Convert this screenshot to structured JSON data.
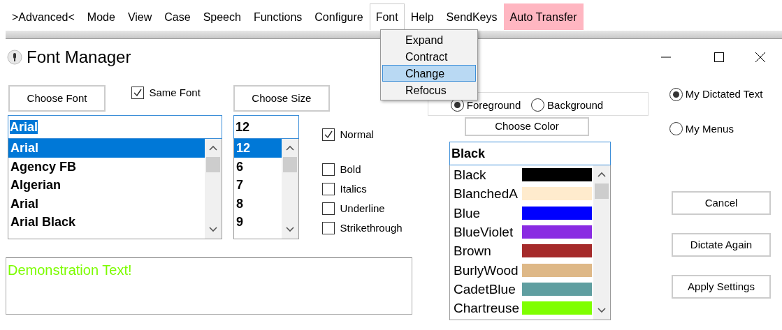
{
  "menu_bar": [
    {
      "label": ">Advanced<",
      "open": false,
      "highlighted": false
    },
    {
      "label": "Mode",
      "open": false,
      "highlighted": false
    },
    {
      "label": "View",
      "open": false,
      "highlighted": false
    },
    {
      "label": "Case",
      "open": false,
      "highlighted": false
    },
    {
      "label": "Speech",
      "open": false,
      "highlighted": false
    },
    {
      "label": "Functions",
      "open": false,
      "highlighted": false
    },
    {
      "label": "Configure",
      "open": false,
      "highlighted": false
    },
    {
      "label": "Font",
      "open": true,
      "highlighted": false
    },
    {
      "label": "Help",
      "open": false,
      "highlighted": false
    },
    {
      "label": "SendKeys",
      "open": false,
      "highlighted": false
    },
    {
      "label": "Auto Transfer",
      "open": false,
      "highlighted": true
    }
  ],
  "font_menu": [
    {
      "label": "Expand",
      "selected": false
    },
    {
      "label": "Contract",
      "selected": false
    },
    {
      "label": "Change",
      "selected": true
    },
    {
      "label": "Refocus",
      "selected": false
    }
  ],
  "window": {
    "title": "Font Manager"
  },
  "choose_font_button": "Choose Font",
  "same_font": {
    "label": "Same Font",
    "checked": true
  },
  "choose_size_button": "Choose Size",
  "font_field": {
    "value": "Arial",
    "text_selected": true
  },
  "font_list": [
    {
      "label": "Arial",
      "selected": true
    },
    {
      "label": "Agency FB",
      "selected": false
    },
    {
      "label": "Algerian",
      "selected": false
    },
    {
      "label": "Arial",
      "selected": false
    },
    {
      "label": "Arial Black",
      "selected": false
    }
  ],
  "size_field": {
    "value": "12"
  },
  "size_list": [
    {
      "label": "12",
      "selected": true
    },
    {
      "label": "6",
      "selected": false
    },
    {
      "label": "7",
      "selected": false
    },
    {
      "label": "8",
      "selected": false
    },
    {
      "label": "9",
      "selected": false
    }
  ],
  "styles": [
    {
      "label": "Normal",
      "checked": true
    },
    {
      "label": "Bold",
      "checked": false
    },
    {
      "label": "Italics",
      "checked": false
    },
    {
      "label": "Underline",
      "checked": false
    },
    {
      "label": "Strikethrough",
      "checked": false
    }
  ],
  "demo_text": "Demonstration Text!",
  "color_target": [
    {
      "label": "Foreground",
      "selected": true
    },
    {
      "label": "Background",
      "selected": false
    }
  ],
  "choose_color_button": "Choose Color",
  "color_field": {
    "value": "Black"
  },
  "color_list": [
    {
      "label": "Black",
      "color": "#000000"
    },
    {
      "label": "BlanchedA",
      "color": "#ffebcd"
    },
    {
      "label": "Blue",
      "color": "#0000ff"
    },
    {
      "label": "BlueViolet",
      "color": "#8a2be2"
    },
    {
      "label": "Brown",
      "color": "#a52a2a"
    },
    {
      "label": "BurlyWood",
      "color": "#deb887"
    },
    {
      "label": "CadetBlue",
      "color": "#5f9ea0"
    },
    {
      "label": "Chartreuse",
      "color": "#7fff00"
    }
  ],
  "apply_to": [
    {
      "label": "My Dictated Text",
      "selected": true
    },
    {
      "label": "My Menus",
      "selected": false
    }
  ],
  "buttons": [
    "Cancel",
    "Dictate Again",
    "Apply Settings"
  ]
}
